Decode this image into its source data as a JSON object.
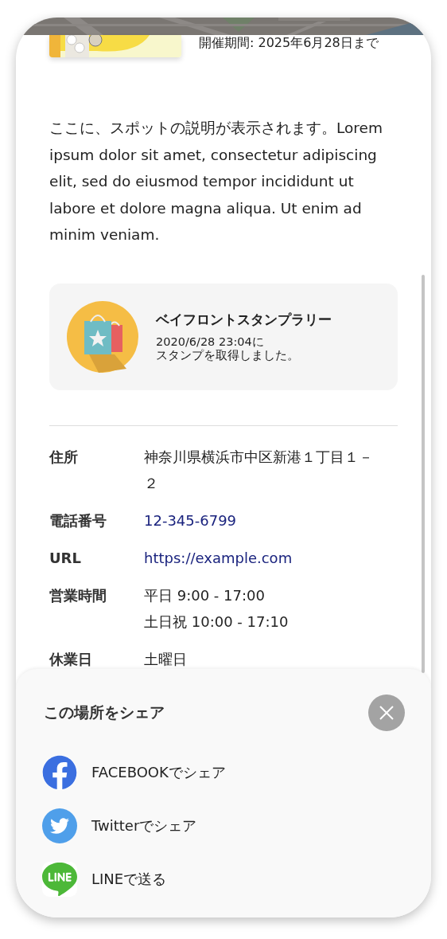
{
  "event": {
    "period": "開催期間: 2025年6月28日まで"
  },
  "description": "ここに、スポットの説明が表示されます。Lorem ipsum dolor sit amet, consectetur adipiscing elit, sed do eiusmod tempor incididunt ut labore et dolore magna aliqua. Ut enim ad minim veniam.",
  "stamp": {
    "title": "ベイフロントスタンプラリー",
    "lines": [
      "2020/6/28 23:04に",
      "スタンプを取得しました。"
    ]
  },
  "details": [
    {
      "label": "住所",
      "kind": "text",
      "lines": [
        "神奈川県横浜市中区新港１丁目１－２"
      ]
    },
    {
      "label": "電話番号",
      "kind": "link",
      "lines": [
        "12-345-6799"
      ]
    },
    {
      "label": "URL",
      "kind": "link",
      "lines": [
        "https://example.com"
      ]
    },
    {
      "label": "営業時間",
      "kind": "text",
      "lines": [
        "平日 9:00 - 17:00",
        "土日祝 10:00 - 17:10"
      ]
    },
    {
      "label": "休業日",
      "kind": "text",
      "lines": [
        "土曜日"
      ]
    }
  ],
  "share": {
    "title": "この場所をシェア",
    "items": [
      {
        "kind": "facebook",
        "label": "FACEBOOKでシェア"
      },
      {
        "kind": "twitter",
        "label": "Twitterでシェア"
      },
      {
        "kind": "line",
        "label": "LINEで送る"
      }
    ]
  }
}
